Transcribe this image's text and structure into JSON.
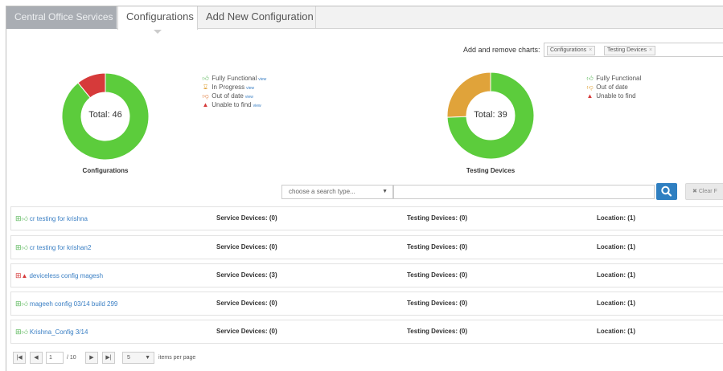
{
  "tabs": [
    {
      "label": "Central Office Services"
    },
    {
      "label": "Configurations"
    },
    {
      "label": "Add New Configuration"
    }
  ],
  "chart_controls": {
    "label": "Add and remove charts:",
    "chips": [
      {
        "label": "Configurations"
      },
      {
        "label": "Testing Devices"
      }
    ]
  },
  "colors": {
    "green": "#5ccc3c",
    "red": "#d63a3a",
    "orange": "#e0a33a",
    "link": "#3a7fc4",
    "button_blue": "#2f7fc1"
  },
  "chart_data": [
    {
      "type": "pie",
      "title": "Configurations",
      "center_label": "Total: 46",
      "total": 46,
      "series": [
        {
          "name": "Fully Functional",
          "value": 41,
          "color": "#5ccc3c"
        },
        {
          "name": "Unable to find",
          "value": 5,
          "color": "#d63a3a"
        }
      ],
      "legend": [
        {
          "label": "Fully Functional",
          "link": "view",
          "icon": "thumbs-up-icon",
          "color": "#5cb85c"
        },
        {
          "label": "In Progress",
          "link": "view",
          "icon": "hourglass-icon",
          "color": "#e0a33a"
        },
        {
          "label": "Out of date",
          "link": "view",
          "icon": "thumbs-down-icon",
          "color": "#e07a3a"
        },
        {
          "label": "Unable to find",
          "link": "view",
          "icon": "warning-icon",
          "color": "#d63a3a"
        }
      ]
    },
    {
      "type": "pie",
      "title": "Testing Devices",
      "center_label": "Total: 39",
      "total": 39,
      "series": [
        {
          "name": "Fully Functional",
          "value": 29,
          "color": "#5ccc3c"
        },
        {
          "name": "Out of date",
          "value": 10,
          "color": "#e0a33a"
        }
      ],
      "legend": [
        {
          "label": "Fully Functional",
          "icon": "thumbs-up-icon",
          "color": "#5cb85c"
        },
        {
          "label": "Out of date",
          "icon": "thumbs-down-icon",
          "color": "#e0a33a"
        },
        {
          "label": "Unable to find",
          "icon": "warning-icon",
          "color": "#d63a3a"
        }
      ]
    }
  ],
  "search": {
    "type_placeholder": "choose a search type...",
    "clear_label": "Clear F"
  },
  "rows": [
    {
      "name": "cr testing for krishna",
      "status_icon": "thumbs-up-icon",
      "service": "Service Devices: (0)",
      "testing": "Testing Devices: (0)",
      "location": "Location: (1)"
    },
    {
      "name": "cr testing for krishan2",
      "status_icon": "thumbs-up-icon",
      "service": "Service Devices: (0)",
      "testing": "Testing Devices: (0)",
      "location": "Location: (1)"
    },
    {
      "name": "deviceless config magesh",
      "status_icon": "warning-icon",
      "service": "Service Devices: (3)",
      "testing": "Testing Devices: (0)",
      "location": "Location: (1)"
    },
    {
      "name": "mageeh config 03/14 build 299",
      "status_icon": "thumbs-up-icon",
      "service": "Service Devices: (0)",
      "testing": "Testing Devices: (0)",
      "location": "Location: (1)"
    },
    {
      "name": "Krishna_Config 3/14",
      "status_icon": "thumbs-up-icon",
      "service": "Service Devices: (0)",
      "testing": "Testing Devices: (0)",
      "location": "Location: (1)"
    }
  ],
  "pager": {
    "page": "1",
    "of_pages": "/ 10",
    "page_size": "5",
    "items_per_page": "items per page"
  }
}
